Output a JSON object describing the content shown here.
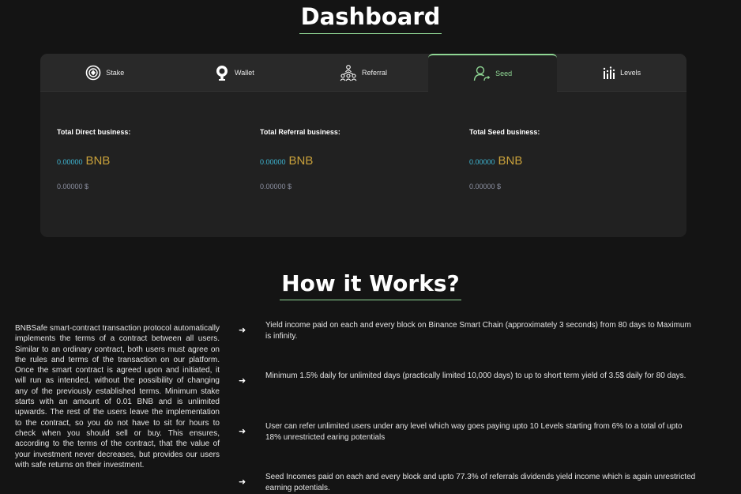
{
  "dashboard": {
    "title": "Dashboard"
  },
  "tabs": [
    {
      "label": "Stake",
      "icon": "stake-icon",
      "active": false
    },
    {
      "label": "Wallet",
      "icon": "wallet-icon",
      "active": false
    },
    {
      "label": "Referral",
      "icon": "referral-icon",
      "active": false
    },
    {
      "label": "Seed",
      "icon": "seed-icon",
      "active": true
    },
    {
      "label": "Levels",
      "icon": "levels-icon",
      "active": false
    }
  ],
  "stats": [
    {
      "label": "Total Direct business:",
      "bnb_value": "0.00000",
      "bnb_unit": "BNB",
      "usd": "0.00000 $"
    },
    {
      "label": "Total Referral business:",
      "bnb_value": "0.00000",
      "bnb_unit": "BNB",
      "usd": "0.00000 $"
    },
    {
      "label": "Total Seed business:",
      "bnb_value": "0.00000",
      "bnb_unit": "BNB",
      "usd": "0.00000 $"
    }
  ],
  "how_it_works": {
    "title": "How it Works?",
    "intro": "BNBSafe smart-contract transaction protocol automatically implements the terms of a contract between all users. Similar to an ordinary contract, both users must agree on the rules and terms of the transaction on our platform. Once the smart contract is agreed upon and initiated, it will run as intended, without the possibility of changing any of the previously established terms. Minimum stake starts with an amount of 0.01 BNB and is unlimited upwards. The rest of the users leave the implementation to the contract, so you do not have to sit for hours to check when you should sell or buy. This ensures, according to the terms of the contract, that the value of your investment never decreases, but provides our users with safe returns on their investment.",
    "arrow": "➜",
    "features": [
      "Yield income paid on each and every block on Binance Smart Chain (approximately 3 seconds) from 80 days to Maximum is infinity.",
      "Minimum 1.5% daily for unlimited days (practically limited 10,000 days) to up to short term yield of 3.5$ daily for 80 days.",
      "User can refer unlimited users under any level which way goes paying upto 10 Levels starting from 6% to a total of upto 18% unrestricted earing potentials",
      "Seed Incomes paid on each and every block and upto 77.3% of referrals dividends yield income which is again unrestricted earning potentials."
    ]
  },
  "colors": {
    "accent": "#8fd694",
    "bnb_value": "#3fb9d6",
    "bnb_unit": "#c9a13b",
    "usd": "#8b8fa0",
    "background": "#141414",
    "panel": "#212121"
  }
}
